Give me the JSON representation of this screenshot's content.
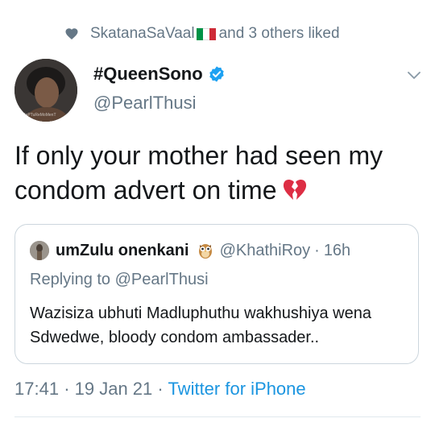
{
  "social_context": {
    "icon": "heart-icon",
    "liker": "SkatanaSaVaal",
    "liker_flag": "italy-flag",
    "others_text": "and 3 others liked"
  },
  "author": {
    "display_name": "#QueenSono",
    "verified": true,
    "handle": "@PearlThusi",
    "avatar_watermark": "CaPTuReMoMenT"
  },
  "tweet": {
    "text": "If only your mother had seen my condom advert on time",
    "emoji": "broken-heart"
  },
  "quoted": {
    "display_name": "umZulu onenkani",
    "emoji": "owl",
    "handle": "@KhathiRoy",
    "separator": "·",
    "time": "16h",
    "replying_to_label": "Replying to",
    "replying_to_handle": "@PearlThusi",
    "text": "Wazisiza ubhuti Madluphuthu wakhushiya wena Sdwedwe, bloody condom ambassader.."
  },
  "footer": {
    "time": "17:41",
    "date": "19 Jan 21",
    "separator": "·",
    "source": "Twitter for iPhone"
  },
  "colors": {
    "secondary_text": "#657786",
    "link": "#1b95e0",
    "verified_badge": "#1da1f2",
    "border": "#ccd6dd"
  }
}
